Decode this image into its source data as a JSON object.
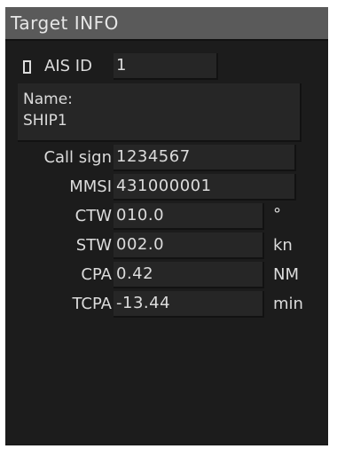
{
  "window": {
    "title": "Target INFO"
  },
  "ais": {
    "label": "AIS ID",
    "value": "1",
    "checkbox_checked": false
  },
  "name": {
    "label": "Name:",
    "value": "SHIP1"
  },
  "fields": {
    "call_sign": {
      "label": "Call sign",
      "value": "1234567"
    },
    "mmsi": {
      "label": "MMSI",
      "value": "431000001"
    },
    "ctw": {
      "label": "CTW",
      "value": "010.0",
      "unit": "°"
    },
    "stw": {
      "label": "STW",
      "value": "002.0",
      "unit": "kn"
    },
    "cpa": {
      "label": "CPA",
      "value": "0.42",
      "unit": "NM"
    },
    "tcpa": {
      "label": "TCPA",
      "value": "-13.44",
      "unit": "min"
    }
  },
  "colors": {
    "panel_bg": "#1c1c1c",
    "titlebar_bg": "#5a5a5a",
    "field_bg": "#262626",
    "text": "#dcdcdc"
  }
}
